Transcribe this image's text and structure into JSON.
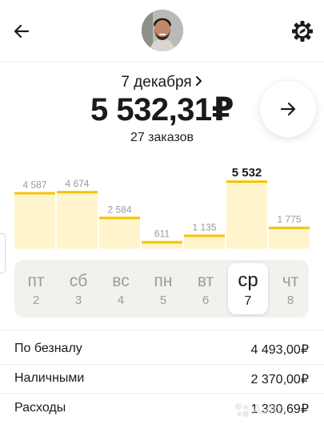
{
  "header": {
    "avatar_alt": "driver avatar"
  },
  "summary": {
    "date": "7 декабря",
    "amount": "5 532,31₽",
    "orders": "27 заказов"
  },
  "chart_data": {
    "type": "bar",
    "categories": [
      "пт 2",
      "сб 3",
      "вс 4",
      "пн 5",
      "вт 6",
      "ср 7",
      "чт 8"
    ],
    "values": [
      4587,
      4674,
      2584,
      611,
      1135,
      5532,
      1775
    ],
    "labels": [
      "4 587",
      "4 674",
      "2 584",
      "611",
      "1 135",
      "5 532",
      "1 775"
    ],
    "selected_index": 5,
    "colors": {
      "bar": "#fff4cc",
      "cap": "#f6c200"
    }
  },
  "days": [
    {
      "name": "пт",
      "date": "2"
    },
    {
      "name": "сб",
      "date": "3"
    },
    {
      "name": "вс",
      "date": "4"
    },
    {
      "name": "пн",
      "date": "5"
    },
    {
      "name": "вт",
      "date": "6"
    },
    {
      "name": "ср",
      "date": "7"
    },
    {
      "name": "чт",
      "date": "8"
    }
  ],
  "breakdown": [
    {
      "label": "По безналу",
      "value": "4 493,00₽"
    },
    {
      "label": "Наличными",
      "value": "2 370,00₽"
    },
    {
      "label": "Расходы",
      "value": "1 330,69₽"
    }
  ],
  "watermark": "Avito"
}
